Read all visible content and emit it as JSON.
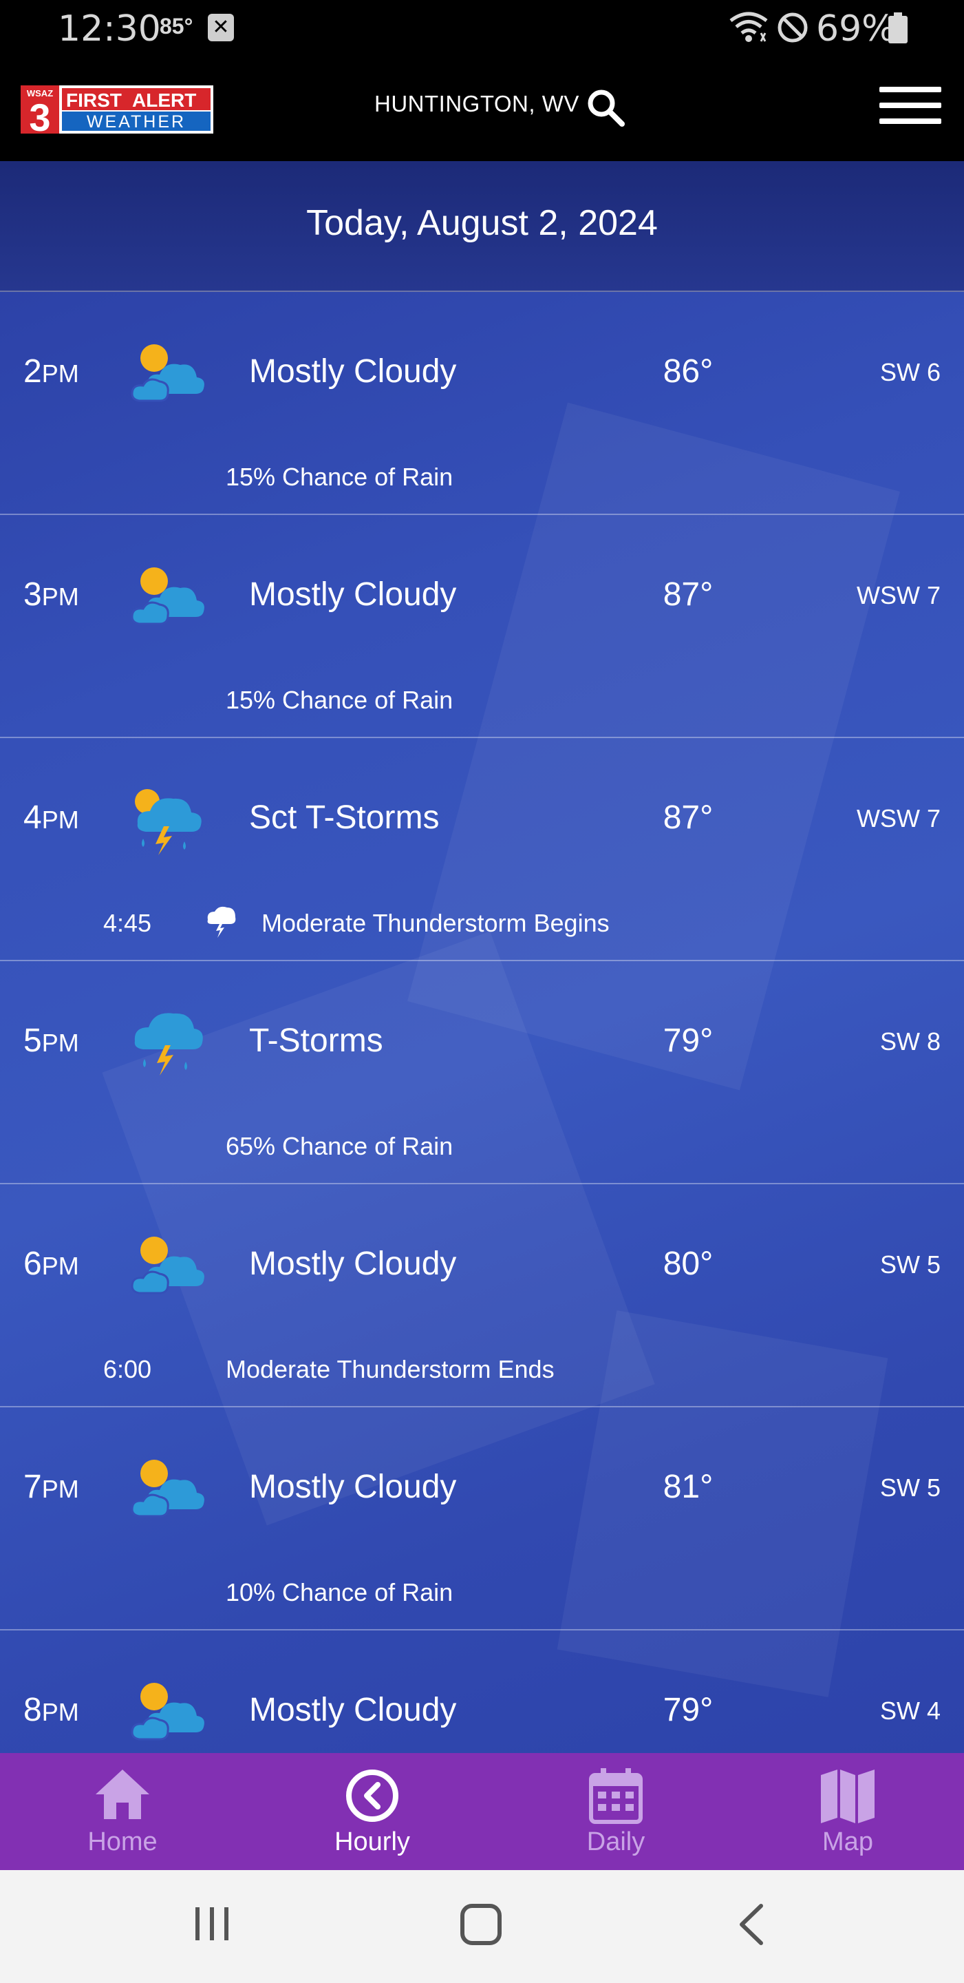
{
  "status_bar": {
    "time": "12:30",
    "temp": "85°",
    "notif_glyph": "✕",
    "battery": "69%",
    "icons": [
      "wifi-icon",
      "do-not-disturb-icon",
      "battery-icon"
    ]
  },
  "header": {
    "logo_top_left": "WSAZ",
    "logo_number": "3",
    "logo_first": "FIRST",
    "logo_alert": "ALERT",
    "logo_weather": "WEATHER",
    "location": "HUNTINGTON, WV"
  },
  "date": "Today, August 2, 2024",
  "hours": [
    {
      "hour": "2",
      "ampm": "PM",
      "icon": "partly-cloudy-icon",
      "condition": "Mostly Cloudy",
      "temp": "86°",
      "wind": "SW 6",
      "sub": "15% Chance of Rain"
    },
    {
      "hour": "3",
      "ampm": "PM",
      "icon": "partly-cloudy-icon",
      "condition": "Mostly Cloudy",
      "temp": "87°",
      "wind": "WSW 7",
      "sub": "15% Chance of Rain"
    },
    {
      "hour": "4",
      "ampm": "PM",
      "icon": "sun-thunderstorm-icon",
      "condition": "Sct T-Storms",
      "temp": "87°",
      "wind": "WSW 7",
      "event_time": "4:45",
      "event_icon": "thunderstorm-small-icon",
      "event_text": "Moderate Thunderstorm Begins"
    },
    {
      "hour": "5",
      "ampm": "PM",
      "icon": "thunderstorm-icon",
      "condition": "T-Storms",
      "temp": "79°",
      "wind": "SW 8",
      "sub": "65% Chance of Rain"
    },
    {
      "hour": "6",
      "ampm": "PM",
      "icon": "partly-cloudy-icon",
      "condition": "Mostly Cloudy",
      "temp": "80°",
      "wind": "SW 5",
      "event_time": "6:00",
      "event_text": "Moderate Thunderstorm Ends"
    },
    {
      "hour": "7",
      "ampm": "PM",
      "icon": "partly-cloudy-icon",
      "condition": "Mostly Cloudy",
      "temp": "81°",
      "wind": "SW 5",
      "sub": "10% Chance of Rain"
    },
    {
      "hour": "8",
      "ampm": "PM",
      "icon": "partly-cloudy-icon",
      "condition": "Mostly Cloudy",
      "temp": "79°",
      "wind": "SW 4"
    }
  ],
  "nav": {
    "home": "Home",
    "hourly": "Hourly",
    "daily": "Daily",
    "map": "Map",
    "active": "Hourly"
  },
  "colors": {
    "nav_bg": "#8230b3",
    "content_bg": "#3550b8",
    "sun": "#f5b21b",
    "cloud": "#2d9ad8"
  }
}
